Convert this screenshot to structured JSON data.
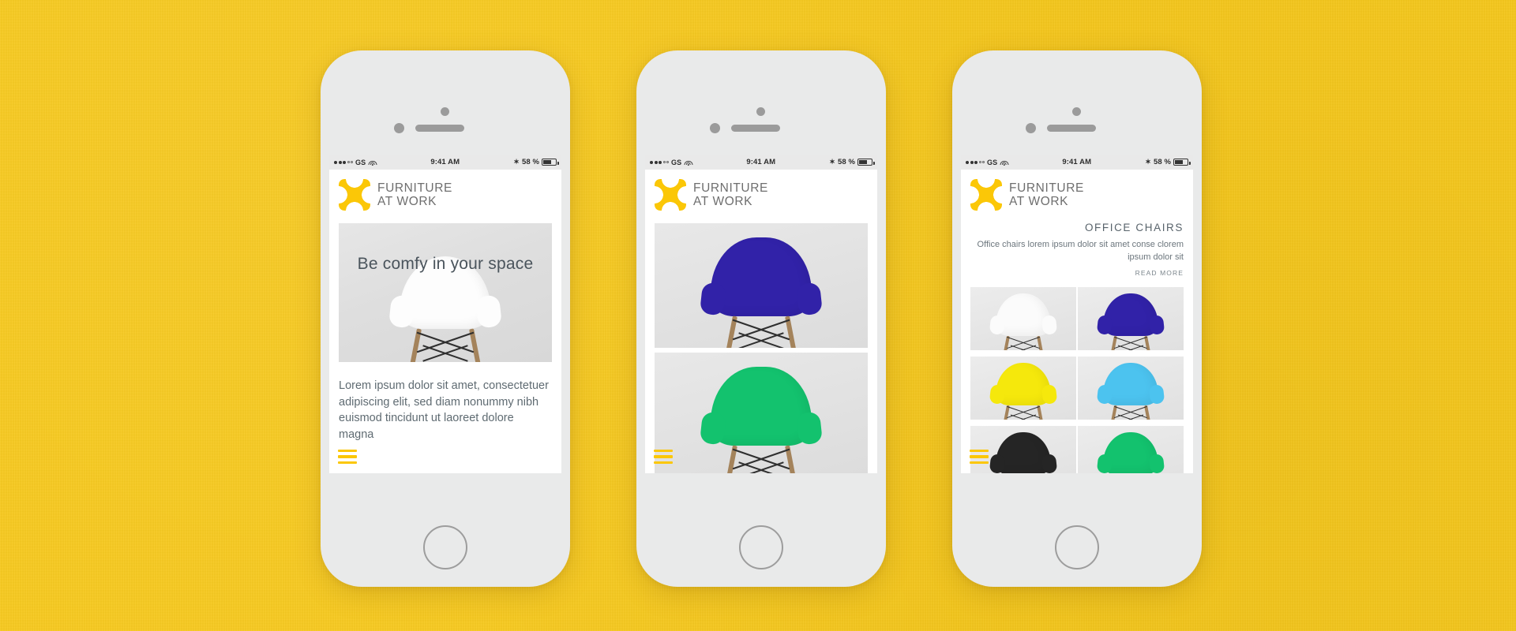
{
  "background": {
    "color": "#F8C91B"
  },
  "brand": {
    "line1": "FURNITURE",
    "line2": "AT WORK",
    "logo_color": "#FBC707"
  },
  "status_bar": {
    "carrier": "GS",
    "time": "9:41 AM",
    "battery_percent": "58 %",
    "bluetooth_icon": "bluetooth-icon",
    "wifi_icon": "wifi-icon",
    "signal_icon": "signal-dots-icon",
    "battery_icon": "battery-icon"
  },
  "phones": [
    {
      "id": "phone-home",
      "screen": "home",
      "hero": {
        "title": "Be comfy in your space",
        "chair_color": "#fdfdfd"
      },
      "paragraph": "Lorem ipsum dolor sit amet, consectetuer adipiscing elit, sed diam nonummy nibh euismod tincidunt ut laoreet dolore magna",
      "menu_icon": "hamburger-menu-icon"
    },
    {
      "id": "phone-products",
      "screen": "products",
      "photos": [
        {
          "chair_color": "#3122a8",
          "label": "blue-chair"
        },
        {
          "chair_color": "#13c26e",
          "label": "green-chair"
        }
      ],
      "menu_icon": "hamburger-menu-icon"
    },
    {
      "id": "phone-category",
      "screen": "category",
      "category": {
        "title": "OFFICE CHAIRS",
        "description": "Office chairs lorem ipsum dolor sit amet conse clorem ipsum dolor sit",
        "read_more": "READ MORE"
      },
      "grid": [
        [
          {
            "chair_color": "#fbfbfb",
            "label": "white-chair"
          },
          {
            "chair_color": "#3122a8",
            "label": "blue-chair"
          }
        ],
        [
          {
            "chair_color": "#f5e80c",
            "label": "yellow-chair"
          },
          {
            "chair_color": "#4cc3ef",
            "label": "light-blue-chair"
          }
        ],
        [
          {
            "chair_color": "#252525",
            "label": "black-chair"
          },
          {
            "chair_color": "#13c26e",
            "label": "green-chair"
          }
        ]
      ],
      "menu_icon": "hamburger-menu-icon"
    }
  ]
}
